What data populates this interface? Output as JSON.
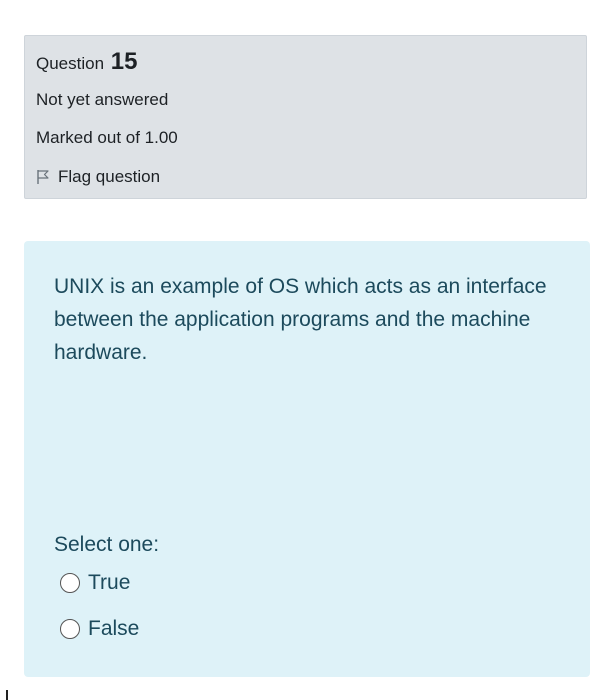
{
  "question_info": {
    "question_label": "Question",
    "question_number": "15",
    "state": "Not yet answered",
    "grade": "Marked out of 1.00",
    "flag_label": "Flag question",
    "flag_icon": "flag-outline-icon"
  },
  "question_content": {
    "text": "UNIX is an example of OS which acts as an interface between the application programs and the machine hardware.",
    "prompt": "Select one:",
    "options": [
      {
        "label": "True",
        "selected": false
      },
      {
        "label": "False",
        "selected": false
      }
    ]
  },
  "colors": {
    "info_background": "#dee2e6",
    "content_background": "#def2f8",
    "content_text": "#1c4a5c"
  }
}
